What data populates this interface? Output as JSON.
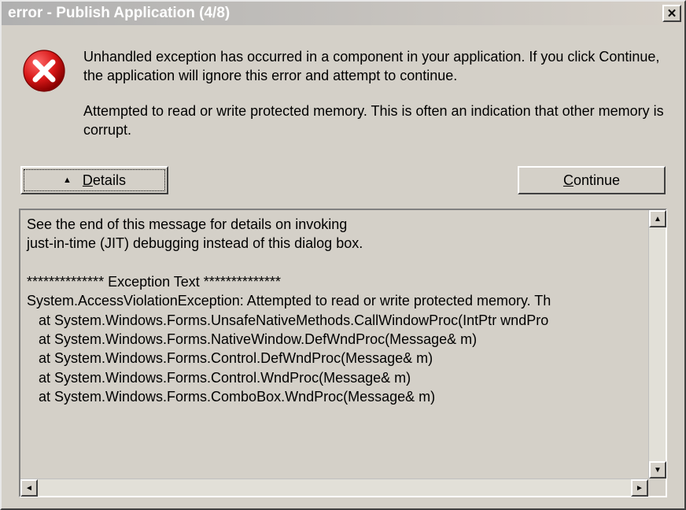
{
  "titlebar": {
    "text": "error - Publish Application (4/8)"
  },
  "messages": {
    "line1": "Unhandled exception has occurred in a component in your application. If you click Continue, the application will ignore this error and attempt to continue.",
    "line2": "Attempted to read or write protected memory. This is often an indication that other memory is corrupt."
  },
  "buttons": {
    "details_label": "etails",
    "details_prefix": "D",
    "continue_label": "ontinue",
    "continue_prefix": "C"
  },
  "details_text": "See the end of this message for details on invoking\njust-in-time (JIT) debugging instead of this dialog box.\n\n************** Exception Text **************\nSystem.AccessViolationException: Attempted to read or write protected memory. Th\n   at System.Windows.Forms.UnsafeNativeMethods.CallWindowProc(IntPtr wndPro\n   at System.Windows.Forms.NativeWindow.DefWndProc(Message& m)\n   at System.Windows.Forms.Control.DefWndProc(Message& m)\n   at System.Windows.Forms.Control.WndProc(Message& m)\n   at System.Windows.Forms.ComboBox.WndProc(Message& m)"
}
